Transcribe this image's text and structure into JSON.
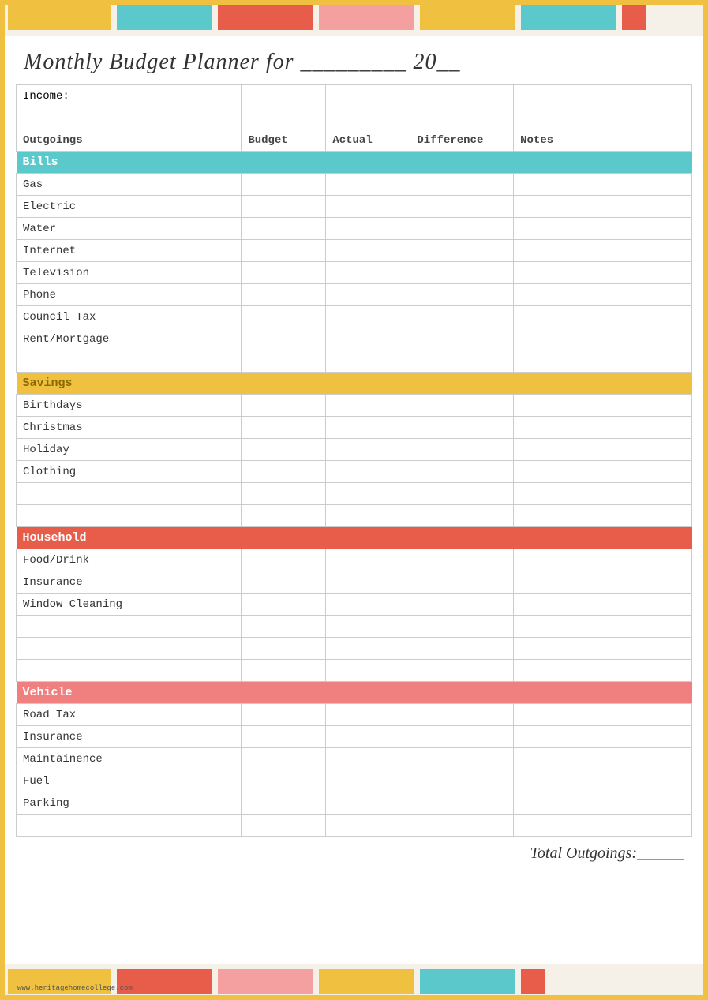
{
  "title": "Monthly Budget Planner for _________ 20__",
  "headers": {
    "outgoings": "Outgoings",
    "budget": "Budget",
    "actual": "Actual",
    "difference": "Difference",
    "notes": "Notes"
  },
  "income_label": "Income:",
  "sections": {
    "bills": {
      "label": "Bills",
      "color": "teal",
      "items": [
        "Gas",
        "Electric",
        "Water",
        "Internet",
        "Television",
        "Phone",
        "Council Tax",
        "Rent/Mortgage"
      ]
    },
    "savings": {
      "label": "Savings",
      "color": "yellow",
      "items": [
        "Birthdays",
        "Christmas",
        "Holiday",
        "Clothing"
      ]
    },
    "household": {
      "label": "Household",
      "color": "red",
      "items": [
        "Food/Drink",
        "Insurance",
        "Window Cleaning"
      ]
    },
    "vehicle": {
      "label": "Vehicle",
      "color": "pink",
      "items": [
        "Road Tax",
        "Insurance",
        "Maintainence",
        "Fuel",
        "Parking"
      ]
    }
  },
  "total_label": "Total Outgoings:______",
  "footer_text": "www.heritagehomecollege.com",
  "bar_segments_top": [
    "yellow",
    "teal",
    "red",
    "pink",
    "yellow",
    "teal",
    "red"
  ],
  "bar_segments_bottom": [
    "yellow",
    "teal",
    "red",
    "pink",
    "yellow",
    "teal",
    "red"
  ]
}
